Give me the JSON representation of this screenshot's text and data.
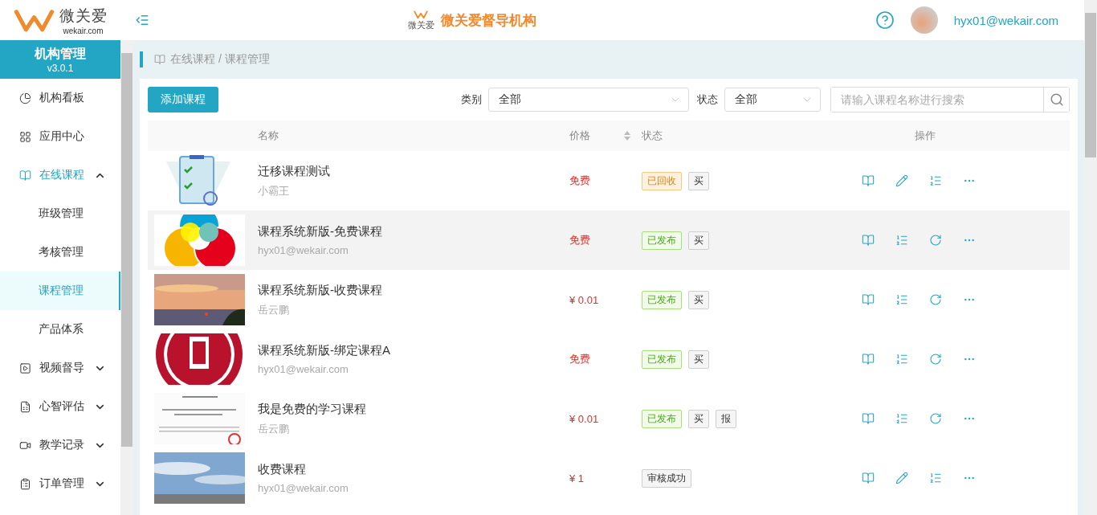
{
  "header": {
    "logo_text": "微关爱",
    "logo_domain": "wekair.com",
    "org_logo_text": "微关爱",
    "org_name": "微关爱督导机构",
    "user": "hyx01@wekair.com"
  },
  "sidebar": {
    "title": "机构管理",
    "version": "v3.0.1",
    "items": [
      {
        "label": "机构看板",
        "selected": false
      },
      {
        "label": "应用中心",
        "selected": false
      },
      {
        "label": "在线课程",
        "selected": true,
        "expanded": true,
        "children": [
          {
            "label": "班级管理",
            "selected": false
          },
          {
            "label": "考核管理",
            "selected": false
          },
          {
            "label": "课程管理",
            "selected": true
          },
          {
            "label": "产品体系",
            "selected": false
          }
        ]
      },
      {
        "label": "视频督导",
        "selected": false,
        "expanded": false
      },
      {
        "label": "心智评估",
        "selected": false,
        "expanded": false
      },
      {
        "label": "教学记录",
        "selected": false,
        "expanded": false
      },
      {
        "label": "订单管理",
        "selected": false,
        "expanded": false
      }
    ]
  },
  "breadcrumb": "在线课程 / 课程管理",
  "toolbar": {
    "add_button": "添加课程",
    "filters": [
      {
        "label": "类别",
        "value": "全部"
      },
      {
        "label": "状态",
        "value": "全部"
      }
    ],
    "search": {
      "placeholder": "请输入课程名称进行搜索"
    }
  },
  "table": {
    "columns": [
      "名称",
      "价格",
      "状态",
      "操作"
    ],
    "rows": [
      {
        "name": "迁移课程测试",
        "author": "小霸王",
        "price": "免费",
        "status": {
          "kind": "recycled",
          "label": "已回收"
        },
        "tags": [
          "买"
        ],
        "hovered": false
      },
      {
        "name": "课程系统新版-免费课程",
        "author": "hyx01@wekair.com",
        "price": "免费",
        "status": {
          "kind": "published",
          "label": "已发布"
        },
        "tags": [
          "买"
        ],
        "hovered": true
      },
      {
        "name": "课程系统新版-收费课程",
        "author": "岳云鹏",
        "price": "¥ 0.01",
        "status": {
          "kind": "published",
          "label": "已发布"
        },
        "tags": [
          "买"
        ],
        "hovered": false
      },
      {
        "name": "课程系统新版-绑定课程A",
        "author": "hyx01@wekair.com",
        "price": "免费",
        "status": {
          "kind": "published",
          "label": "已发布"
        },
        "tags": [
          "买"
        ],
        "hovered": false
      },
      {
        "name": "我是免费的学习课程",
        "author": "岳云鹏",
        "price": "¥ 0.01",
        "status": {
          "kind": "published",
          "label": "已发布"
        },
        "tags": [
          "买",
          "报"
        ],
        "hovered": false
      },
      {
        "name": "收费课程",
        "author": "hyx01@wekair.com",
        "price": "¥ 1",
        "status": {
          "kind": "approved",
          "label": "审核成功"
        },
        "tags": [],
        "hovered": false
      }
    ]
  }
}
